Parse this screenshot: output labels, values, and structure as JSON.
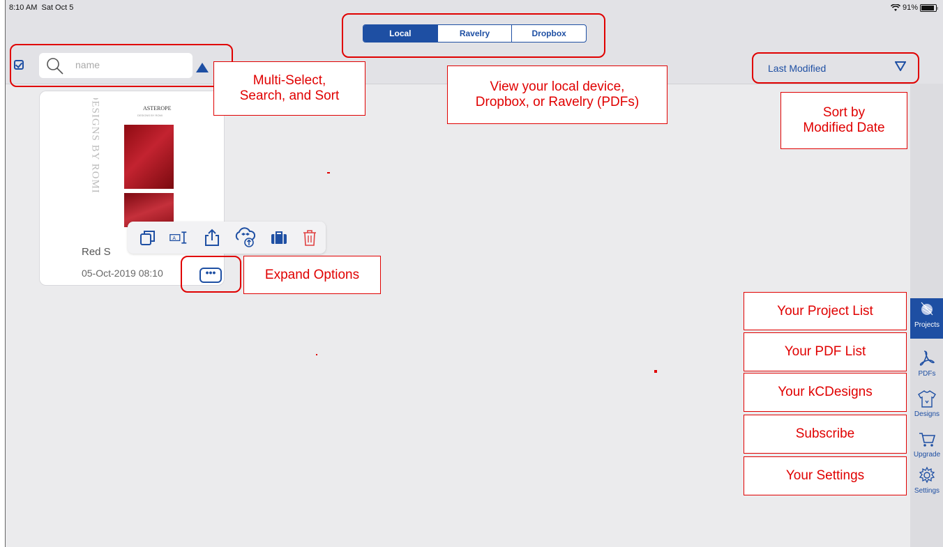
{
  "status": {
    "time": "8:10 AM",
    "date": "Sat Oct 5",
    "battery": "91%"
  },
  "tabs": [
    "Local",
    "Ravelry",
    "Dropbox"
  ],
  "search": {
    "placeholder": "name"
  },
  "sort": {
    "label": "Last Modified"
  },
  "card": {
    "cover_title": "ASTEROPE",
    "cover_subtitle": "DESIGNS BY ROMI",
    "cover_vertical_text": "DESIGNS BY ROMI",
    "name": "Red S",
    "date": "05-Oct-2019 08:10",
    "more_label": "•••"
  },
  "toolbar_icons": [
    "duplicate-icon",
    "rename-icon",
    "share-icon",
    "dropbox-upload-icon",
    "briefcase-icon",
    "trash-icon"
  ],
  "sidebar": [
    {
      "label": "Projects",
      "icon": "yarn-icon",
      "active": true
    },
    {
      "label": "PDFs",
      "icon": "pdf-icon",
      "active": false
    },
    {
      "label": "Designs",
      "icon": "sweater-icon",
      "active": false
    },
    {
      "label": "Upgrade",
      "icon": "cart-icon",
      "active": false
    },
    {
      "label": "Settings",
      "icon": "gear-icon",
      "active": false
    }
  ],
  "callouts": {
    "multiselect": "Multi-Select, Search, and Sort",
    "view_source": "View your local device, Dropbox, or Ravelry (PDFs)",
    "sort_modified": "Sort by Modified Date",
    "expand": "Expand Options",
    "project_list": "Your Project List",
    "pdf_list": "Your PDF List",
    "kcdesigns": "Your kCDesigns",
    "subscribe": "Subscribe",
    "settings": "Your Settings"
  },
  "colors": {
    "accent": "#1e4fa3",
    "annotation": "#e00000",
    "background": "#ebebed"
  }
}
